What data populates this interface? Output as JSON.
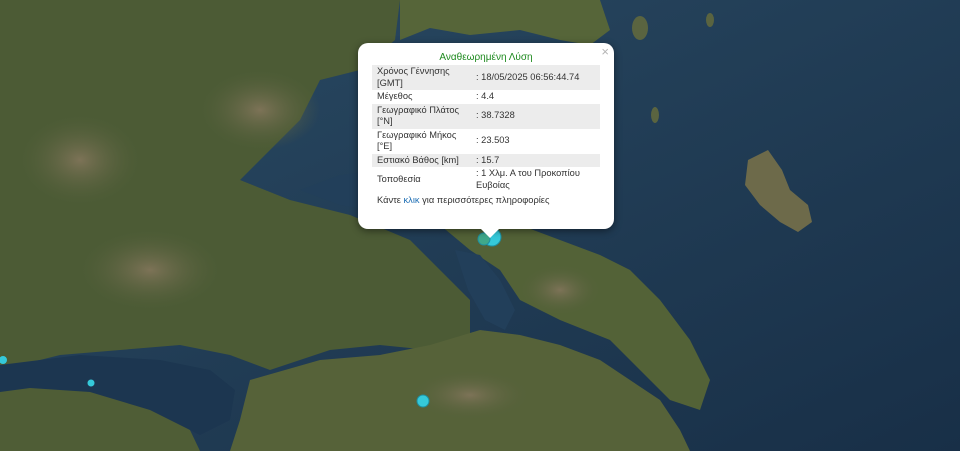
{
  "map": {
    "colors": {
      "sea": "#1d3b57",
      "land": "#4d5c36",
      "mountain": "#6f6548",
      "marker": "#2ec4d6"
    }
  },
  "popup": {
    "close_symbol": "×",
    "title": "Αναθεωρημένη Λύση",
    "rows": [
      {
        "label": "Χρόνος Γέννησης [GMT]",
        "value": ": 18/05/2025 06:56:44.74"
      },
      {
        "label": "Μέγεθος",
        "value": ": 4.4"
      },
      {
        "label": "Γεωγραφικό Πλάτος [°N]",
        "value": ": 38.7328"
      },
      {
        "label": "Γεωγραφικό Μήκος [°E]",
        "value": ": 23.503"
      },
      {
        "label": "Εστιακό Βάθος [km]",
        "value": ": 15.7"
      },
      {
        "label": "Τοποθεσία",
        "value": ": 1 Χλμ. Α του Προκοπίου Ευβοίας"
      }
    ],
    "footer_prefix": "Κάντε",
    "footer_link": "κλικ",
    "footer_suffix": "για περισσότερες πληροφορίες"
  }
}
